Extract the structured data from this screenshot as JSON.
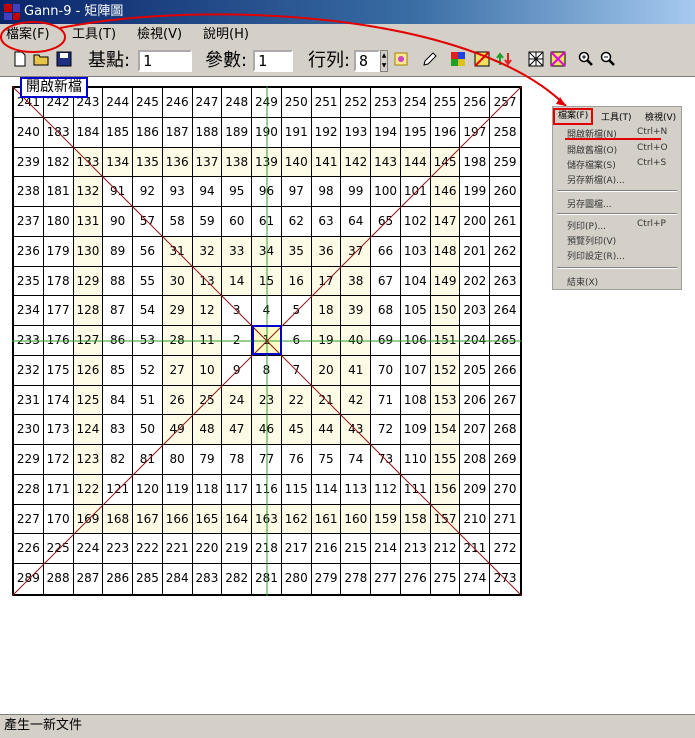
{
  "window": {
    "title": "Gann-9 - 矩陣圖"
  },
  "menubar": {
    "items": [
      {
        "label": "檔案(F)"
      },
      {
        "label": "工具(T)"
      },
      {
        "label": "檢視(V)"
      },
      {
        "label": "說明(H)"
      }
    ]
  },
  "toolbar": {
    "base_label": "基點:",
    "base_value": "1",
    "param_label": "參數:",
    "param_value": "1",
    "rowcol_label": "行列:",
    "rowcol_value": "8"
  },
  "grid": {
    "size": 17,
    "rows": [
      [
        "241",
        "242",
        "243",
        "244",
        "245",
        "246",
        "247",
        "248",
        "249",
        "250",
        "251",
        "252",
        "253",
        "254",
        "255",
        "256",
        "257"
      ],
      [
        "240",
        "183",
        "184",
        "185",
        "186",
        "187",
        "188",
        "189",
        "190",
        "191",
        "192",
        "193",
        "194",
        "195",
        "196",
        "197",
        "258"
      ],
      [
        "239",
        "182",
        "133",
        "134",
        "135",
        "136",
        "137",
        "138",
        "139",
        "140",
        "141",
        "142",
        "143",
        "144",
        "145",
        "198",
        "259"
      ],
      [
        "238",
        "181",
        "132",
        "91",
        "92",
        "93",
        "94",
        "95",
        "96",
        "97",
        "98",
        "99",
        "100",
        "101",
        "146",
        "199",
        "260"
      ],
      [
        "237",
        "180",
        "131",
        "90",
        "57",
        "58",
        "59",
        "60",
        "61",
        "62",
        "63",
        "64",
        "65",
        "102",
        "147",
        "200",
        "261"
      ],
      [
        "236",
        "179",
        "130",
        "89",
        "56",
        "31",
        "32",
        "33",
        "34",
        "35",
        "36",
        "37",
        "66",
        "103",
        "148",
        "201",
        "262"
      ],
      [
        "235",
        "178",
        "129",
        "88",
        "55",
        "30",
        "13",
        "14",
        "15",
        "16",
        "17",
        "38",
        "67",
        "104",
        "149",
        "202",
        "263"
      ],
      [
        "234",
        "177",
        "128",
        "87",
        "54",
        "29",
        "12",
        "3",
        "4",
        "5",
        "18",
        "39",
        "68",
        "105",
        "150",
        "203",
        "264"
      ],
      [
        "233",
        "176",
        "127",
        "86",
        "53",
        "28",
        "11",
        "2",
        "1",
        "6",
        "19",
        "40",
        "69",
        "106",
        "151",
        "204",
        "265"
      ],
      [
        "232",
        "175",
        "126",
        "85",
        "52",
        "27",
        "10",
        "9",
        "8",
        "7",
        "20",
        "41",
        "70",
        "107",
        "152",
        "205",
        "266"
      ],
      [
        "231",
        "174",
        "125",
        "84",
        "51",
        "26",
        "25",
        "24",
        "23",
        "22",
        "21",
        "42",
        "71",
        "108",
        "153",
        "206",
        "267"
      ],
      [
        "230",
        "173",
        "124",
        "83",
        "50",
        "49",
        "48",
        "47",
        "46",
        "45",
        "44",
        "43",
        "72",
        "109",
        "154",
        "207",
        "268"
      ],
      [
        "229",
        "172",
        "123",
        "82",
        "81",
        "80",
        "79",
        "78",
        "77",
        "76",
        "75",
        "74",
        "73",
        "110",
        "155",
        "208",
        "269"
      ],
      [
        "228",
        "171",
        "122",
        "121",
        "120",
        "119",
        "118",
        "117",
        "116",
        "115",
        "114",
        "113",
        "112",
        "111",
        "156",
        "209",
        "270"
      ],
      [
        "227",
        "170",
        "169",
        "168",
        "167",
        "166",
        "165",
        "164",
        "163",
        "162",
        "161",
        "160",
        "159",
        "158",
        "157",
        "210",
        "271"
      ],
      [
        "226",
        "225",
        "224",
        "223",
        "222",
        "221",
        "220",
        "219",
        "218",
        "217",
        "216",
        "215",
        "214",
        "213",
        "212",
        "211",
        "272"
      ],
      [
        "289",
        "288",
        "287",
        "286",
        "285",
        "284",
        "283",
        "282",
        "281",
        "280",
        "279",
        "278",
        "277",
        "276",
        "275",
        "274",
        "273"
      ]
    ]
  },
  "tooltip": "開啟新檔",
  "popup_menu": {
    "top_items": [
      {
        "label": "檔案(F)"
      },
      {
        "label": "工具(T)"
      },
      {
        "label": "檢視(V)"
      }
    ],
    "items": [
      {
        "label": "開啟新檔(N)",
        "shortcut": "Ctrl+N"
      },
      {
        "label": "開啟舊檔(O)",
        "shortcut": "Ctrl+O"
      },
      {
        "label": "儲存檔案(S)",
        "shortcut": "Ctrl+S"
      },
      {
        "label": "另存新檔(A)...",
        "shortcut": ""
      },
      {
        "label": "另存圖檔...",
        "shortcut": ""
      },
      {
        "label": "列印(P)...",
        "shortcut": "Ctrl+P"
      },
      {
        "label": "預覽列印(V)",
        "shortcut": ""
      },
      {
        "label": "列印設定(R)...",
        "shortcut": ""
      },
      {
        "label": "結束(X)",
        "shortcut": ""
      }
    ]
  },
  "statusbar": {
    "text": "產生一新文件"
  },
  "colors": {
    "annotation_red": "#e00000",
    "highlight_blue": "#0000cc",
    "diagonal": "#8b1a1a",
    "axis_green": "#2e9e2e"
  },
  "toolbar_icons": [
    "new-icon",
    "open-icon",
    "save-icon",
    "color-fill-icon",
    "pencil-icon",
    "color-grid-icon",
    "diagonal-grid-icon",
    "up-down-arrows-icon",
    "cross-grid-icon",
    "x-grid-icon",
    "zoom-in-icon",
    "zoom-out-icon"
  ]
}
